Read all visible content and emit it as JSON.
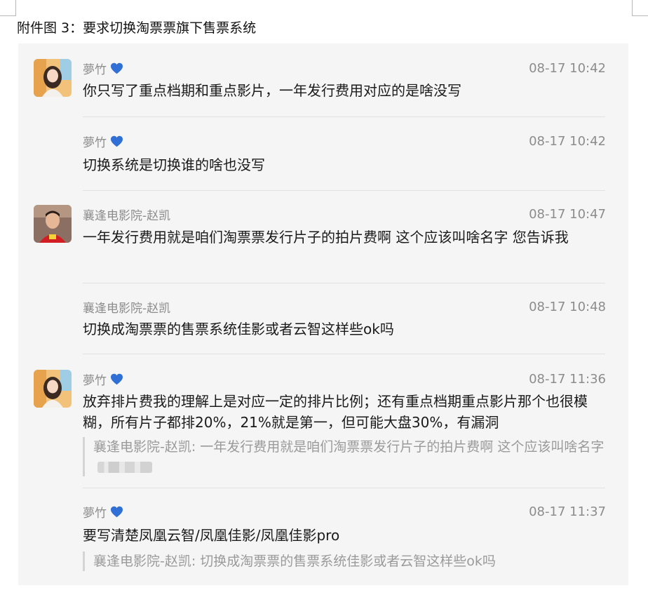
{
  "caption": "附件图 3：要求切换淘票票旗下售票系统",
  "messages": [
    {
      "sender": "夢竹",
      "time": "08-17 10:42",
      "text": "你只写了重点档期和重点影片，一年发行费用对应的是啥没写",
      "avatar": "avatar-woman-icon",
      "verified": true
    },
    {
      "sender": "夢竹",
      "time": "08-17 10:42",
      "text": "切换系统是切换谁的啥也没写",
      "verified": true
    },
    {
      "sender": "襄逢电影院-赵凯",
      "time": "08-17 10:47",
      "text": "一年发行费用就是咱们淘票票发行片子的拍片费啊  这个应该叫啥名字  您告诉我",
      "avatar": "avatar-man-icon"
    },
    {
      "sender": "襄逢电影院-赵凯",
      "time": "08-17 10:48",
      "text": "切换成淘票票的售票系统佳影或者云智这样些ok吗"
    },
    {
      "sender": "夢竹",
      "time": "08-17 11:36",
      "text": "放弃排片费我的理解上是对应一定的排片比例；还有重点档期重点影片那个也很模糊，所有片子都排20%，21%就是第一，但可能大盘30%，有漏洞",
      "avatar": "avatar-woman-icon",
      "verified": true,
      "quote": "襄逢电影院-赵凯: 一年发行费用就是咱们淘票票发行片子的拍片费啊  这个应该叫啥名字"
    },
    {
      "sender": "夢竹",
      "time": "08-17 11:37",
      "text": "要写清楚凤凰云智/凤凰佳影/凤凰佳影pro",
      "verified": true,
      "quote": "襄逢电影院-赵凯: 切换成淘票票的售票系统佳影或者云智这样些ok吗"
    }
  ],
  "colors": {
    "panel": "#f5f5f5",
    "meta": "#8c8c8c",
    "heart": "#2f6fd6",
    "quote_bar": "#d4d4d4"
  }
}
